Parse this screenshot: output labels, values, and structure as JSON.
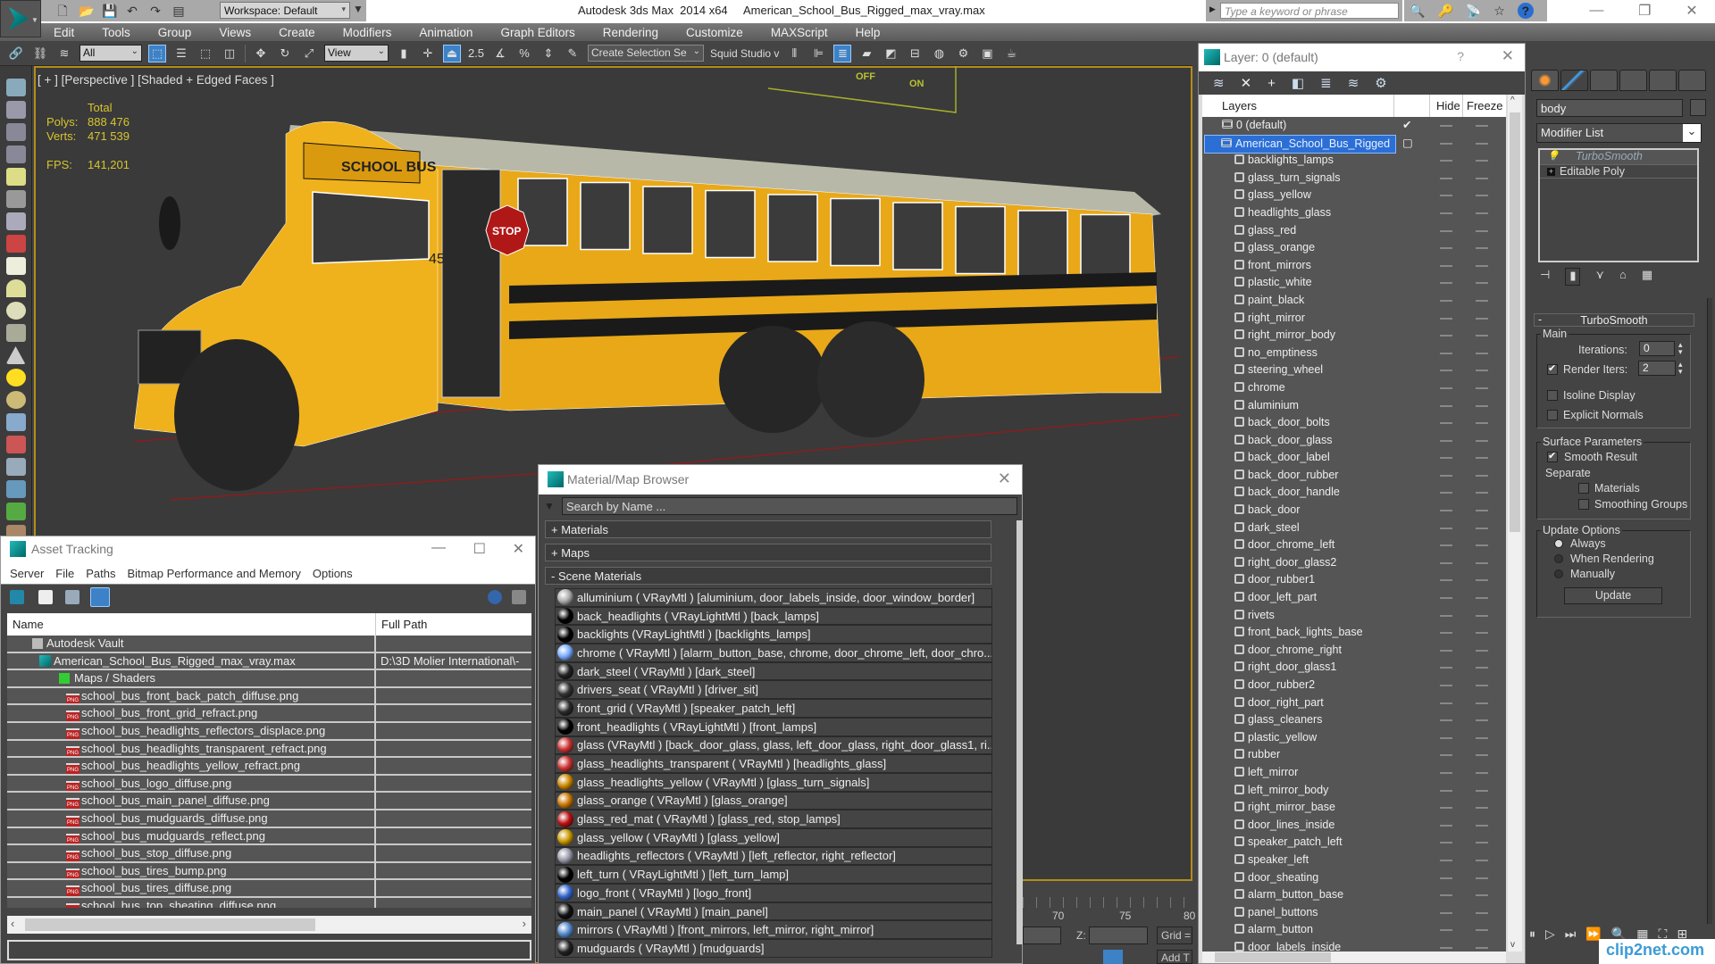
{
  "app": {
    "title": "Autodesk 3ds Max  2014 x64     American_School_Bus_Rigged_max_vray.max",
    "workspace": "Workspace: Default",
    "search_placeholder": "Type a keyword or phrase"
  },
  "menu": [
    "Edit",
    "Tools",
    "Group",
    "Views",
    "Create",
    "Modifiers",
    "Animation",
    "Graph Editors",
    "Rendering",
    "Customize",
    "MAXScript",
    "Help"
  ],
  "toolbar": {
    "selection_filter": "All",
    "ref_coord": "View",
    "named_selection": "Create Selection Se",
    "squid_label": "Squid Studio v"
  },
  "viewport": {
    "label": "[ + ] [Perspective ] [Shaded + Edged Faces ]",
    "stats": {
      "header": "Total",
      "polys_label": "Polys:",
      "polys": "888 476",
      "verts_label": "Verts:",
      "verts": "471 539",
      "fps_label": "FPS:",
      "fps": "141,201"
    },
    "overlay_off": "OFF",
    "overlay_on": "ON",
    "bus_number": "45",
    "bus_sign": "SCHOOL BUS",
    "stop_sign": "STOP"
  },
  "asset_tracking": {
    "title": "Asset Tracking",
    "menu": [
      "Server",
      "File",
      "Paths",
      "Bitmap Performance and Memory",
      "Options"
    ],
    "columns": [
      "Name",
      "Full Path"
    ],
    "rows": [
      {
        "name": "Autodesk Vault",
        "path": "",
        "level": 1,
        "icon": "vault"
      },
      {
        "name": "American_School_Bus_Rigged_max_vray.max",
        "path": "D:\\3D Molier International\\-",
        "level": 2,
        "icon": "max"
      },
      {
        "name": "Maps / Shaders",
        "path": "",
        "level": 3,
        "icon": "maps"
      },
      {
        "name": "school_bus_front_back_patch_diffuse.png",
        "path": "",
        "level": 4,
        "icon": "png"
      },
      {
        "name": "school_bus_front_grid_refract.png",
        "path": "",
        "level": 4,
        "icon": "png"
      },
      {
        "name": "school_bus_headlights_reflectors_displace.png",
        "path": "",
        "level": 4,
        "icon": "png"
      },
      {
        "name": "school_bus_headlights_transparent_refract.png",
        "path": "",
        "level": 4,
        "icon": "png"
      },
      {
        "name": "school_bus_headlights_yellow_refract.png",
        "path": "",
        "level": 4,
        "icon": "png"
      },
      {
        "name": "school_bus_logo_diffuse.png",
        "path": "",
        "level": 4,
        "icon": "png"
      },
      {
        "name": "school_bus_main_panel_diffuse.png",
        "path": "",
        "level": 4,
        "icon": "png"
      },
      {
        "name": "school_bus_mudguards_diffuse.png",
        "path": "",
        "level": 4,
        "icon": "png"
      },
      {
        "name": "school_bus_mudguards_reflect.png",
        "path": "",
        "level": 4,
        "icon": "png"
      },
      {
        "name": "school_bus_stop_diffuse.png",
        "path": "",
        "level": 4,
        "icon": "png"
      },
      {
        "name": "school_bus_tires_bump.png",
        "path": "",
        "level": 4,
        "icon": "png"
      },
      {
        "name": "school_bus_tires_diffuse.png",
        "path": "",
        "level": 4,
        "icon": "png"
      },
      {
        "name": "school_bus_top_sheating_diffuse.png",
        "path": "",
        "level": 4,
        "icon": "png"
      }
    ]
  },
  "material_browser": {
    "title": "Material/Map Browser",
    "search_placeholder": "Search by Name ...",
    "groups": [
      "+ Materials",
      "+ Maps",
      "-  Scene Materials"
    ],
    "materials": [
      {
        "text": "alluminium  ( VRayMtl ) [aluminium, door_labels_inside, door_window_border]",
        "swatch": "#aaa"
      },
      {
        "text": "back_headlights  ( VRayLightMtl ) [back_lamps]",
        "swatch": "#000"
      },
      {
        "text": "backlights  (VRayLightMtl ) [backlights_lamps]",
        "swatch": "#000"
      },
      {
        "text": "chrome  ( VRayMtl ) [alarm_button_base, chrome, door_chrome_left, door_chro...",
        "swatch": "#7af"
      },
      {
        "text": "dark_steel  ( VRayMtl ) [dark_steel]",
        "swatch": "#222"
      },
      {
        "text": "drivers_seat  ( VRayMtl ) [driver_sit]",
        "swatch": "#333"
      },
      {
        "text": "front_grid  ( VRayMtl ) [speaker_patch_left]",
        "swatch": "#2a2a2a"
      },
      {
        "text": "front_headlights  ( VRayLightMtl ) [front_lamps]",
        "swatch": "#000"
      },
      {
        "text": "glass  (VRayMtl ) [back_door_glass, glass, left_door_glass, right_door_glass1, ri...",
        "swatch": "#c33"
      },
      {
        "text": "glass_headlights_transparent ( VRayMtl ) [headlights_glass]",
        "swatch": "#c33"
      },
      {
        "text": "glass_headlights_yellow ( VRayMtl ) [glass_turn_signals]",
        "swatch": "#c80"
      },
      {
        "text": "glass_orange  ( VRayMtl ) [glass_orange]",
        "swatch": "#c70"
      },
      {
        "text": "glass_red_mat  ( VRayMtl ) [glass_red, stop_lamps]",
        "swatch": "#b11"
      },
      {
        "text": "glass_yellow  ( VRayMtl ) [glass_yellow]",
        "swatch": "#c90"
      },
      {
        "text": "headlights_reflectors  ( VRayMtl ) [left_reflector, right_reflector]",
        "swatch": "#99a"
      },
      {
        "text": "left_turn  ( VRayLightMtl ) [left_turn_lamp]",
        "swatch": "#000"
      },
      {
        "text": "logo_front  ( VRayMtl ) [logo_front]",
        "swatch": "#36c"
      },
      {
        "text": "main_panel  ( VRayMtl ) [main_panel]",
        "swatch": "#111"
      },
      {
        "text": "mirrors  ( VRayMtl ) [front_mirrors, left_mirror, right_mirror]",
        "swatch": "#58c"
      },
      {
        "text": "mudguards  ( VRayMtl ) [mudguards]",
        "swatch": "#222"
      }
    ]
  },
  "layer_dialog": {
    "title": "Layer: 0 (default)",
    "help": "?",
    "columns": [
      "Layers",
      "Hide",
      "Freeze"
    ],
    "default_layer": "0 (default)",
    "selected_layer": "American_School_Bus_Rigged",
    "objects": [
      "backlights_lamps",
      "glass_turn_signals",
      "glass_yellow",
      "headlights_glass",
      "glass_red",
      "glass_orange",
      "front_mirrors",
      "plastic_white",
      "paint_black",
      "right_mirror",
      "right_mirror_body",
      "no_emptiness",
      "steering_wheel",
      "chrome",
      "aluminium",
      "back_door_bolts",
      "back_door_glass",
      "back_door_label",
      "back_door_rubber",
      "back_door_handle",
      "back_door",
      "dark_steel",
      "door_chrome_left",
      "right_door_glass2",
      "door_rubber1",
      "door_left_part",
      "rivets",
      "front_back_lights_base",
      "door_chrome_right",
      "right_door_glass1",
      "door_rubber2",
      "door_right_part",
      "glass_cleaners",
      "plastic_yellow",
      "rubber",
      "left_mirror",
      "left_mirror_body",
      "right_mirror_base",
      "door_lines_inside",
      "speaker_patch_left",
      "speaker_left",
      "door_sheating",
      "alarm_button_base",
      "panel_buttons",
      "alarm_button",
      "door_labels_inside"
    ]
  },
  "command_panel": {
    "object_name": "body",
    "modifier_list": "Modifier List",
    "stack": [
      "TurboSmooth",
      "Editable Poly"
    ],
    "rollout_title": "TurboSmooth",
    "main_group": "Main",
    "iterations_label": "Iterations:",
    "iterations": "0",
    "render_iters_label": "Render Iters:",
    "render_iters": "2",
    "render_iters_checked": true,
    "isoline_label": "Isoline Display",
    "isoline_checked": false,
    "explicit_normals_label": "Explicit Normals",
    "explicit_normals_checked": false,
    "surface_group": "Surface Parameters",
    "smooth_result_label": "Smooth Result",
    "smooth_result_checked": true,
    "separate_label": "Separate",
    "materials_label": "Materials",
    "materials_checked": false,
    "smoothing_groups_label": "Smoothing Groups",
    "smoothing_groups_checked": false,
    "update_group": "Update Options",
    "update_options": [
      "Always",
      "When Rendering",
      "Manually"
    ],
    "update_selected": "Always",
    "update_button": "Update"
  },
  "timeline": {
    "ticks": [
      "70",
      "75",
      "80"
    ],
    "z_label": "Z:",
    "grid_label": "Grid =",
    "add_label": "Add T"
  },
  "watermark": "clip2net.com"
}
